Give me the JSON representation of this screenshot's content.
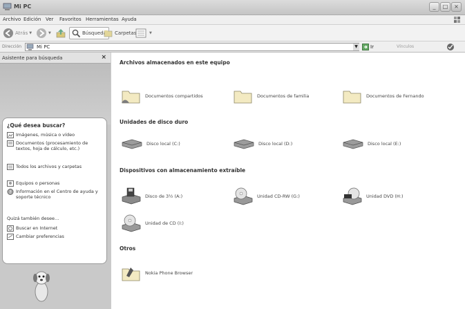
{
  "window": {
    "title": "Mi PC"
  },
  "menu": [
    {
      "label": "Archivo",
      "u": "A"
    },
    {
      "label": "Edición",
      "u": "E"
    },
    {
      "label": "Ver",
      "u": "V"
    },
    {
      "label": "Favoritos",
      "u": "F"
    },
    {
      "label": "Herramientas",
      "u": "H"
    },
    {
      "label": "Ayuda",
      "u": "y"
    }
  ],
  "toolbar": {
    "back": "Atrás",
    "search": "Búsqueda",
    "folders": "Carpetas"
  },
  "address": {
    "label": "Dirección",
    "value": "Mi PC",
    "go": "Ir",
    "links": "Vínculos"
  },
  "left_pane": {
    "title": "Asistente para búsqueda",
    "close": "×",
    "question": "¿Qué desea buscar?",
    "options": [
      "Imágenes, música o vídeo",
      "Documentos (procesamiento de textos, hoja de cálculo, etc.)",
      "Todos los archivos y carpetas",
      "Equipos o personas",
      "Información en el Centro de ayuda y soporte técnico"
    ],
    "also_label": "Quizá también desee…",
    "extra_options": [
      "Buscar en Internet",
      "Cambiar preferencias"
    ]
  },
  "main": {
    "sections": [
      {
        "title": "Archivos almacenados en este equipo",
        "items": [
          "Documentos compartidos",
          "Documentos de familia",
          "Documentos de Fernando"
        ]
      },
      {
        "title": "Unidades de disco duro",
        "items": [
          "Disco local (C:)",
          "Disco local (D:)",
          "Disco local (E:)"
        ]
      },
      {
        "title": "Dispositivos con almacenamiento extraíble",
        "items": [
          "Disco de 3½ (A:)",
          "Unidad CD-RW (G:)",
          "Unidad DVD (H:)",
          "Unidad de CD (I:)"
        ]
      },
      {
        "title": "Otros",
        "items": [
          "Nokia Phone Browser"
        ]
      }
    ]
  }
}
